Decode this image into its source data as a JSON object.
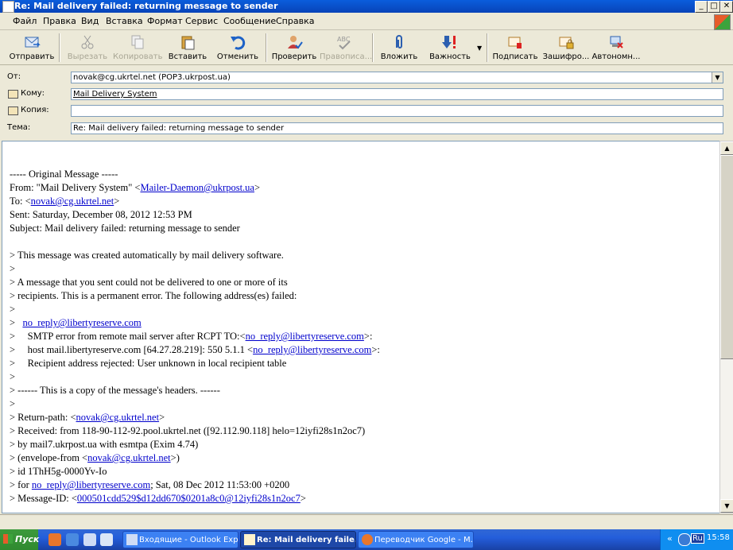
{
  "window": {
    "title": "Re: Mail delivery failed: returning message to sender"
  },
  "menu": [
    "Файл",
    "Правка",
    "Вид",
    "Вставка",
    "Формат",
    "Сервис",
    "Сообщение",
    "Справка"
  ],
  "toolbar": [
    {
      "label": "Отправить",
      "icon": "send-icon",
      "enabled": true
    },
    {
      "label": "Вырезать",
      "icon": "scissors-icon",
      "enabled": false
    },
    {
      "label": "Копировать",
      "icon": "copy-icon",
      "enabled": false
    },
    {
      "label": "Вставить",
      "icon": "paste-icon",
      "enabled": true
    },
    {
      "label": "Отменить",
      "icon": "undo-icon",
      "enabled": true
    },
    {
      "label": "Проверить",
      "icon": "check-names-icon",
      "enabled": true
    },
    {
      "label": "Правописа...",
      "icon": "spelling-icon",
      "enabled": false
    },
    {
      "label": "Вложить",
      "icon": "paperclip-icon",
      "enabled": true
    },
    {
      "label": "Важность",
      "icon": "priority-icon",
      "enabled": true
    },
    {
      "label": "Подписать",
      "icon": "sign-icon",
      "enabled": true
    },
    {
      "label": "Зашифро...",
      "icon": "encrypt-icon",
      "enabled": true
    },
    {
      "label": "Автономн...",
      "icon": "offline-icon",
      "enabled": true
    }
  ],
  "header": {
    "from_label": "От:",
    "from_value": "novak@cg.ukrtel.net    (POP3.ukrpost.ua)",
    "to_label": "Кому:",
    "to_value": "Mail Delivery System",
    "cc_label": "Копия:",
    "cc_value": "",
    "subject_label": "Тема:",
    "subject_value": "Re: Mail delivery failed: returning message to sender"
  },
  "body_lines": [
    [
      {
        "t": "----- Original Message -----"
      }
    ],
    [
      {
        "t": "From: \"Mail Delivery System\" <"
      },
      {
        "t": "Mailer-Daemon@ukrpost.ua",
        "link": true
      },
      {
        "t": ">"
      }
    ],
    [
      {
        "t": "To: <"
      },
      {
        "t": "novak@cg.ukrtel.net",
        "link": true
      },
      {
        "t": ">"
      }
    ],
    [
      {
        "t": "Sent: Saturday, December 08, 2012 12:53 PM"
      }
    ],
    [
      {
        "t": "Subject: Mail delivery failed: returning message to sender"
      }
    ],
    [],
    [
      {
        "t": "> This message was created automatically by mail delivery software."
      }
    ],
    [
      {
        "t": ">"
      }
    ],
    [
      {
        "t": "> A message that you sent could not be delivered to one or more of its"
      }
    ],
    [
      {
        "t": "> recipients. This is a permanent error. The following address(es) failed:"
      }
    ],
    [
      {
        "t": ">"
      }
    ],
    [
      {
        "t": ">   "
      },
      {
        "t": "no_reply@libertyreserve.com",
        "link": true
      }
    ],
    [
      {
        "t": ">     SMTP error from remote mail server after RCPT TO:<"
      },
      {
        "t": "no_reply@libertyreserve.com",
        "link": true
      },
      {
        "t": ">:"
      }
    ],
    [
      {
        "t": ">     host mail.libertyreserve.com [64.27.28.219]: 550 5.1.1 <"
      },
      {
        "t": "no_reply@libertyreserve.com",
        "link": true
      },
      {
        "t": ">:"
      }
    ],
    [
      {
        "t": ">     Recipient address rejected: User unknown in local recipient table"
      }
    ],
    [
      {
        "t": ">"
      }
    ],
    [
      {
        "t": "> ------ This is a copy of the message's headers. ------"
      }
    ],
    [
      {
        "t": ">"
      }
    ],
    [
      {
        "t": "> Return-path: <"
      },
      {
        "t": "novak@cg.ukrtel.net",
        "link": true
      },
      {
        "t": ">"
      }
    ],
    [
      {
        "t": "> Received: from 118-90-112-92.pool.ukrtel.net ([92.112.90.118] helo=12iyfi28s1n2oc7)"
      }
    ],
    [
      {
        "t": "> by mail7.ukrpost.ua with esmtpa (Exim 4.74)"
      }
    ],
    [
      {
        "t": "> (envelope-from <"
      },
      {
        "t": "novak@cg.ukrtel.net",
        "link": true
      },
      {
        "t": ">)"
      }
    ],
    [
      {
        "t": "> id 1ThH5g-0000Yv-Io"
      }
    ],
    [
      {
        "t": "> for "
      },
      {
        "t": "no_reply@libertyreserve.com",
        "link": true
      },
      {
        "t": "; Sat, 08 Dec 2012 11:53:00 +0200"
      }
    ],
    [
      {
        "t": "> Message-ID: <"
      },
      {
        "t": "000501cdd529$d12dd670$0201a8c0@12iyfi28s1n2oc7",
        "link": true
      },
      {
        "t": ">"
      }
    ]
  ],
  "taskbar": {
    "start_label": "Пуск",
    "tasks": [
      {
        "label": "Входящие - Outlook Exp...",
        "active": false
      },
      {
        "label": "Re: Mail delivery faile...",
        "active": true
      },
      {
        "label": "Переводчик Google - M...",
        "active": false
      }
    ],
    "lang": "Ru",
    "time": "15:58"
  },
  "colors": {
    "titlebar": "#0a5ddc",
    "link": "#0000cc",
    "taskbar": "#245edb",
    "start": "#3c9a3c"
  }
}
